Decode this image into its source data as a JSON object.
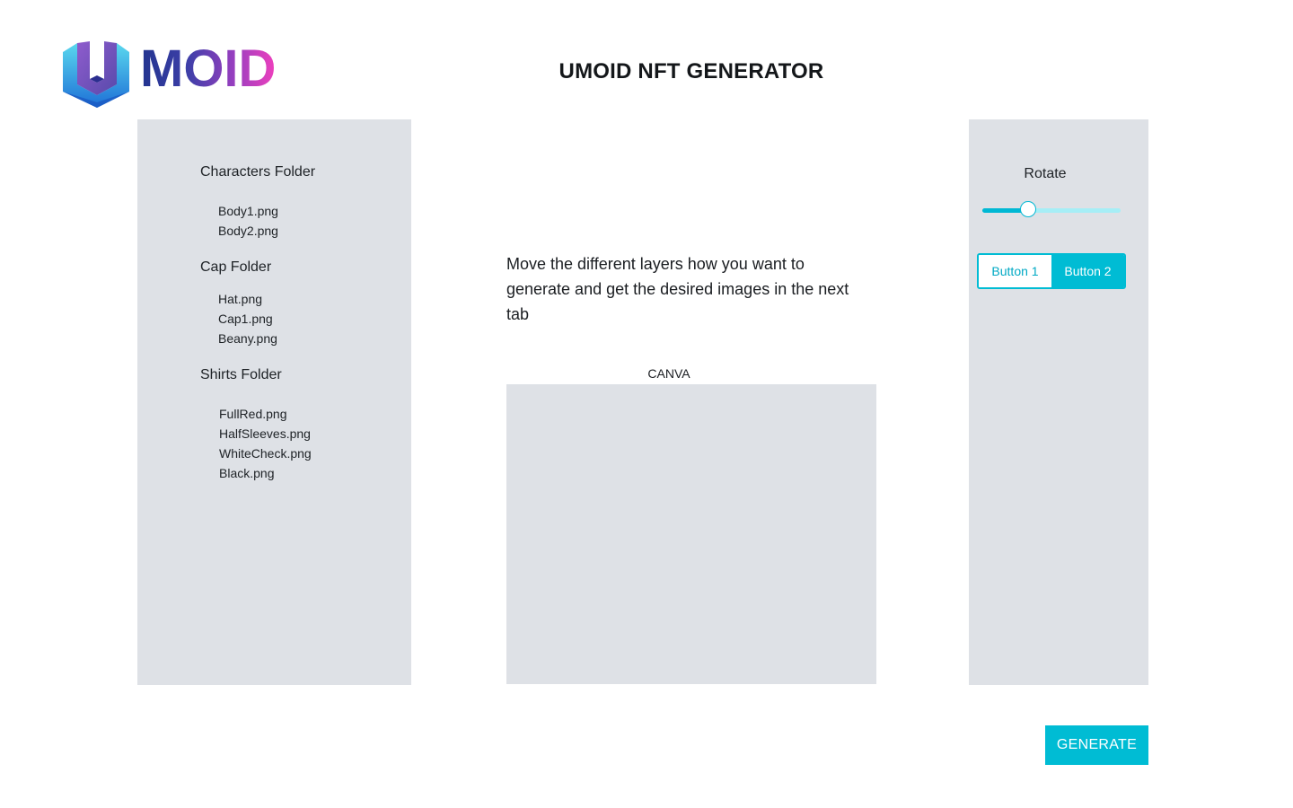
{
  "header": {
    "logo_text": "MOID",
    "title": "UMOID NFT GENERATOR"
  },
  "folders": [
    {
      "label": "Characters Folder",
      "files": [
        "Body1.png",
        "Body2.png"
      ]
    },
    {
      "label": "Cap Folder",
      "files": [
        "Hat.png",
        "Cap1.png",
        "Beany.png"
      ]
    },
    {
      "label": "Shirts Folder",
      "files": [
        "FullRed.png",
        "HalfSleeves.png",
        "WhiteCheck.png",
        "Black.png"
      ]
    }
  ],
  "main": {
    "instructions": "Move the different layers how you want to generate and get the desired images in the next tab",
    "canvas_label": "CANVA"
  },
  "controls": {
    "rotate_label": "Rotate",
    "rotate_value": 0.33,
    "button_1": "Button 1",
    "button_2": "Button 2",
    "selected_button": "Button 2"
  },
  "actions": {
    "generate_label": "GENERATE"
  },
  "colors": {
    "accent": "#00bcd4",
    "panel": "#dee1e6",
    "logo_blue": "#22348f",
    "logo_pink": "#ee3fbd"
  }
}
